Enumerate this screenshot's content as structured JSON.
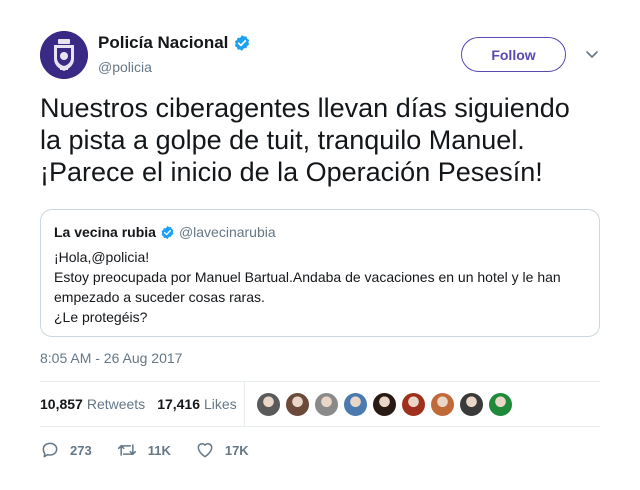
{
  "author": {
    "name": "Policía Nacional",
    "handle": "@policia",
    "verified": true,
    "avatar_icon": "police-badge-icon",
    "avatar_color": "#3a2a86"
  },
  "follow_label": "Follow",
  "tweet_text": [
    "Nuestros ciberagentes llevan días siguiendo",
    "la pista a golpe de tuit, tranquilo Manuel.",
    "¡Parece el inicio de la Operación Pesesín!"
  ],
  "quoted": {
    "name": "La vecina rubia",
    "handle": "@lavecinarubia",
    "verified": true,
    "lines": [
      "¡Hola,@policia!",
      "Estoy preocupada por Manuel Bartual.Andaba de vacaciones en un hotel y le han",
      "empezado a suceder cosas raras.",
      "¿Le protegéis?"
    ]
  },
  "timestamp": "8:05 AM - 26 Aug 2017",
  "stats": {
    "retweets_count": "10,857",
    "retweets_label": "Retweets",
    "likes_count": "17,416",
    "likes_label": "Likes"
  },
  "likers": [
    {
      "name": "liker-avatar-1",
      "color": "#5a5a5a"
    },
    {
      "name": "liker-avatar-2",
      "color": "#6b4a3a"
    },
    {
      "name": "liker-avatar-3",
      "color": "#8a8a8a"
    },
    {
      "name": "liker-avatar-4",
      "color": "#4a7ab0"
    },
    {
      "name": "liker-avatar-5",
      "color": "#2a1a14"
    },
    {
      "name": "liker-avatar-6",
      "color": "#a0301e"
    },
    {
      "name": "liker-avatar-7",
      "color": "#c06a3a"
    },
    {
      "name": "liker-avatar-8",
      "color": "#3a3a3a"
    },
    {
      "name": "liker-avatar-9",
      "color": "#1e8a3a"
    }
  ],
  "actions": {
    "replies": "273",
    "retweets": "11K",
    "likes": "17K"
  },
  "colors": {
    "accent": "#5b48b0",
    "verified": "#1da1f2",
    "muted": "#657786",
    "border": "#ccd6dd"
  }
}
